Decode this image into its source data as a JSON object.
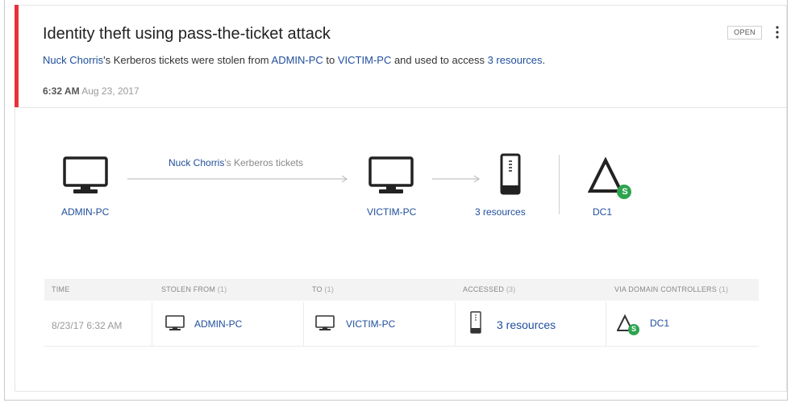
{
  "alert": {
    "title": "Identity theft using pass-the-ticket attack",
    "status": "OPEN",
    "description": {
      "user": "Nuck Chorris",
      "text1": "'s Kerberos tickets were stolen from ",
      "from": "ADMIN-PC",
      "text2": " to ",
      "to": "VICTIM-PC",
      "text3": " and used to access ",
      "resources": "3 resources",
      "text4": "."
    },
    "time": {
      "clock": "6:32 AM",
      "date": "Aug 23, 2017"
    }
  },
  "flow": {
    "arrow_label_user": "Nuck Chorris",
    "arrow_label_rest": "'s Kerberos tickets",
    "source": "ADMIN-PC",
    "target": "VICTIM-PC",
    "resources": "3 resources",
    "dc": "DC1",
    "dc_badge": "S"
  },
  "table": {
    "headers": [
      {
        "label": "TIME",
        "count": ""
      },
      {
        "label": "STOLEN FROM",
        "count": "(1)"
      },
      {
        "label": "TO",
        "count": "(1)"
      },
      {
        "label": "ACCESSED",
        "count": "(3)"
      },
      {
        "label": "VIA DOMAIN CONTROLLERS",
        "count": "(1)"
      }
    ],
    "row": {
      "time": "8/23/17 6:32 AM",
      "stolen_from": "ADMIN-PC",
      "to": "VICTIM-PC",
      "accessed": "3 resources",
      "via": "DC1",
      "via_badge": "S"
    }
  },
  "colors": {
    "accent_red": "#e8303a",
    "link_blue": "#1f4e9c",
    "badge_green": "#2ea44f"
  }
}
